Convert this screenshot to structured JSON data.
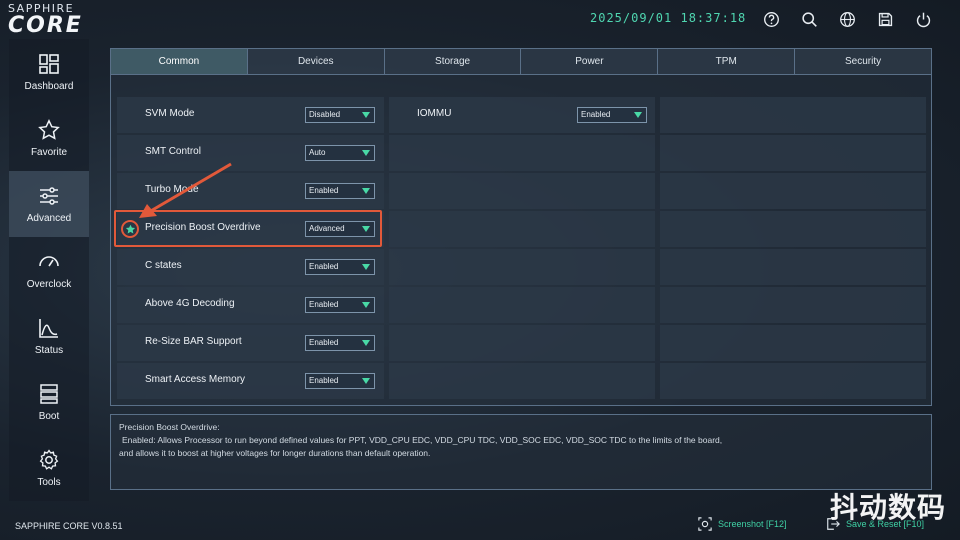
{
  "brand": {
    "top": "SAPPHIRE",
    "main": "CORE"
  },
  "header": {
    "datetime": "2025/09/01 18:37:18"
  },
  "header_icons": [
    "help-icon",
    "search-icon",
    "globe-icon",
    "save-icon",
    "power-icon"
  ],
  "sidebar": {
    "items": [
      {
        "label": "Dashboard",
        "icon": "dashboard-icon"
      },
      {
        "label": "Favorite",
        "icon": "star-icon"
      },
      {
        "label": "Advanced",
        "icon": "sliders-icon",
        "active": true
      },
      {
        "label": "Overclock",
        "icon": "gauge-icon"
      },
      {
        "label": "Status",
        "icon": "chart-icon"
      },
      {
        "label": "Boot",
        "icon": "server-icon"
      },
      {
        "label": "Tools",
        "icon": "gear-icon"
      }
    ]
  },
  "tabs": [
    "Common",
    "Devices",
    "Storage",
    "Power",
    "TPM",
    "Security"
  ],
  "active_tab": "Common",
  "options_col1": [
    {
      "label": "SVM Mode",
      "value": "Disabled"
    },
    {
      "label": "SMT Control",
      "value": "Auto"
    },
    {
      "label": "Turbo Mode",
      "value": "Enabled"
    },
    {
      "label": "Precision Boost Overdrive",
      "value": "Advanced"
    },
    {
      "label": "C states",
      "value": "Enabled"
    },
    {
      "label": "Above 4G Decoding",
      "value": "Enabled"
    },
    {
      "label": "Re-Size BAR Support",
      "value": "Enabled"
    },
    {
      "label": "Smart Access Memory",
      "value": "Enabled"
    }
  ],
  "options_col2": [
    {
      "label": "IOMMU",
      "value": "Enabled"
    }
  ],
  "description": {
    "title": "Precision Boost Overdrive:",
    "line1": "Enabled: Allows Processor to run beyond defined values for PPT, VDD_CPU EDC, VDD_CPU TDC, VDD_SOC EDC, VDD_SOC TDC to the limits of the board,",
    "line2": "and allows it to boost at higher voltages for longer durations than default operation."
  },
  "footer": {
    "version": "SAPPHIRE CORE V0.8.51",
    "screenshot": "Screenshot [F12]",
    "save_reset": "Save & Reset [F10]"
  },
  "watermark": "抖动数码",
  "colors": {
    "accent": "#3fd0a4",
    "highlight": "#e2593a",
    "caret": "#49d9a6"
  }
}
